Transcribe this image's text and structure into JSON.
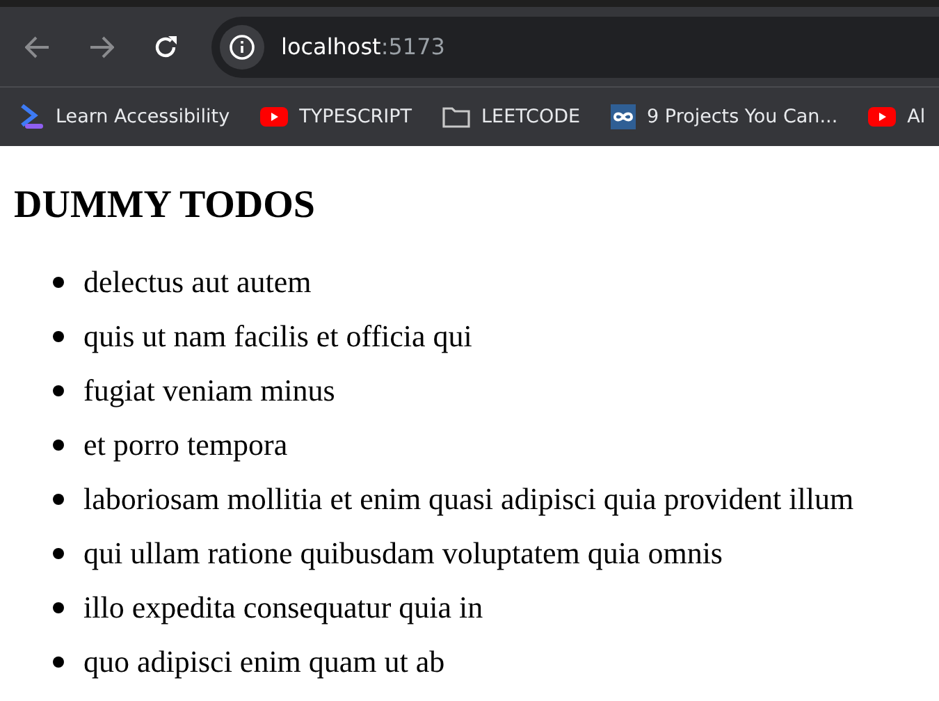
{
  "browser": {
    "address": {
      "host": "localhost",
      "port": ":5173"
    },
    "bookmarks": [
      {
        "kind": "accessibility",
        "label": "Learn Accessibility"
      },
      {
        "kind": "youtube",
        "label": "TYPESCRIPT"
      },
      {
        "kind": "folder",
        "label": "LEETCODE"
      },
      {
        "kind": "infinity",
        "label": "9 Projects You Can..."
      },
      {
        "kind": "youtube",
        "label": "Al"
      }
    ]
  },
  "page": {
    "heading": "DUMMY TODOS",
    "todos": [
      "delectus aut autem",
      "quis ut nam facilis et officia qui",
      "fugiat veniam minus",
      "et porro tempora",
      "laboriosam mollitia et enim quasi adipisci quia provident illum",
      "qui ullam ratione quibusdam voluptatem quia omnis",
      "illo expedita consequatur quia in",
      "quo adipisci enim quam ut ab"
    ]
  }
}
